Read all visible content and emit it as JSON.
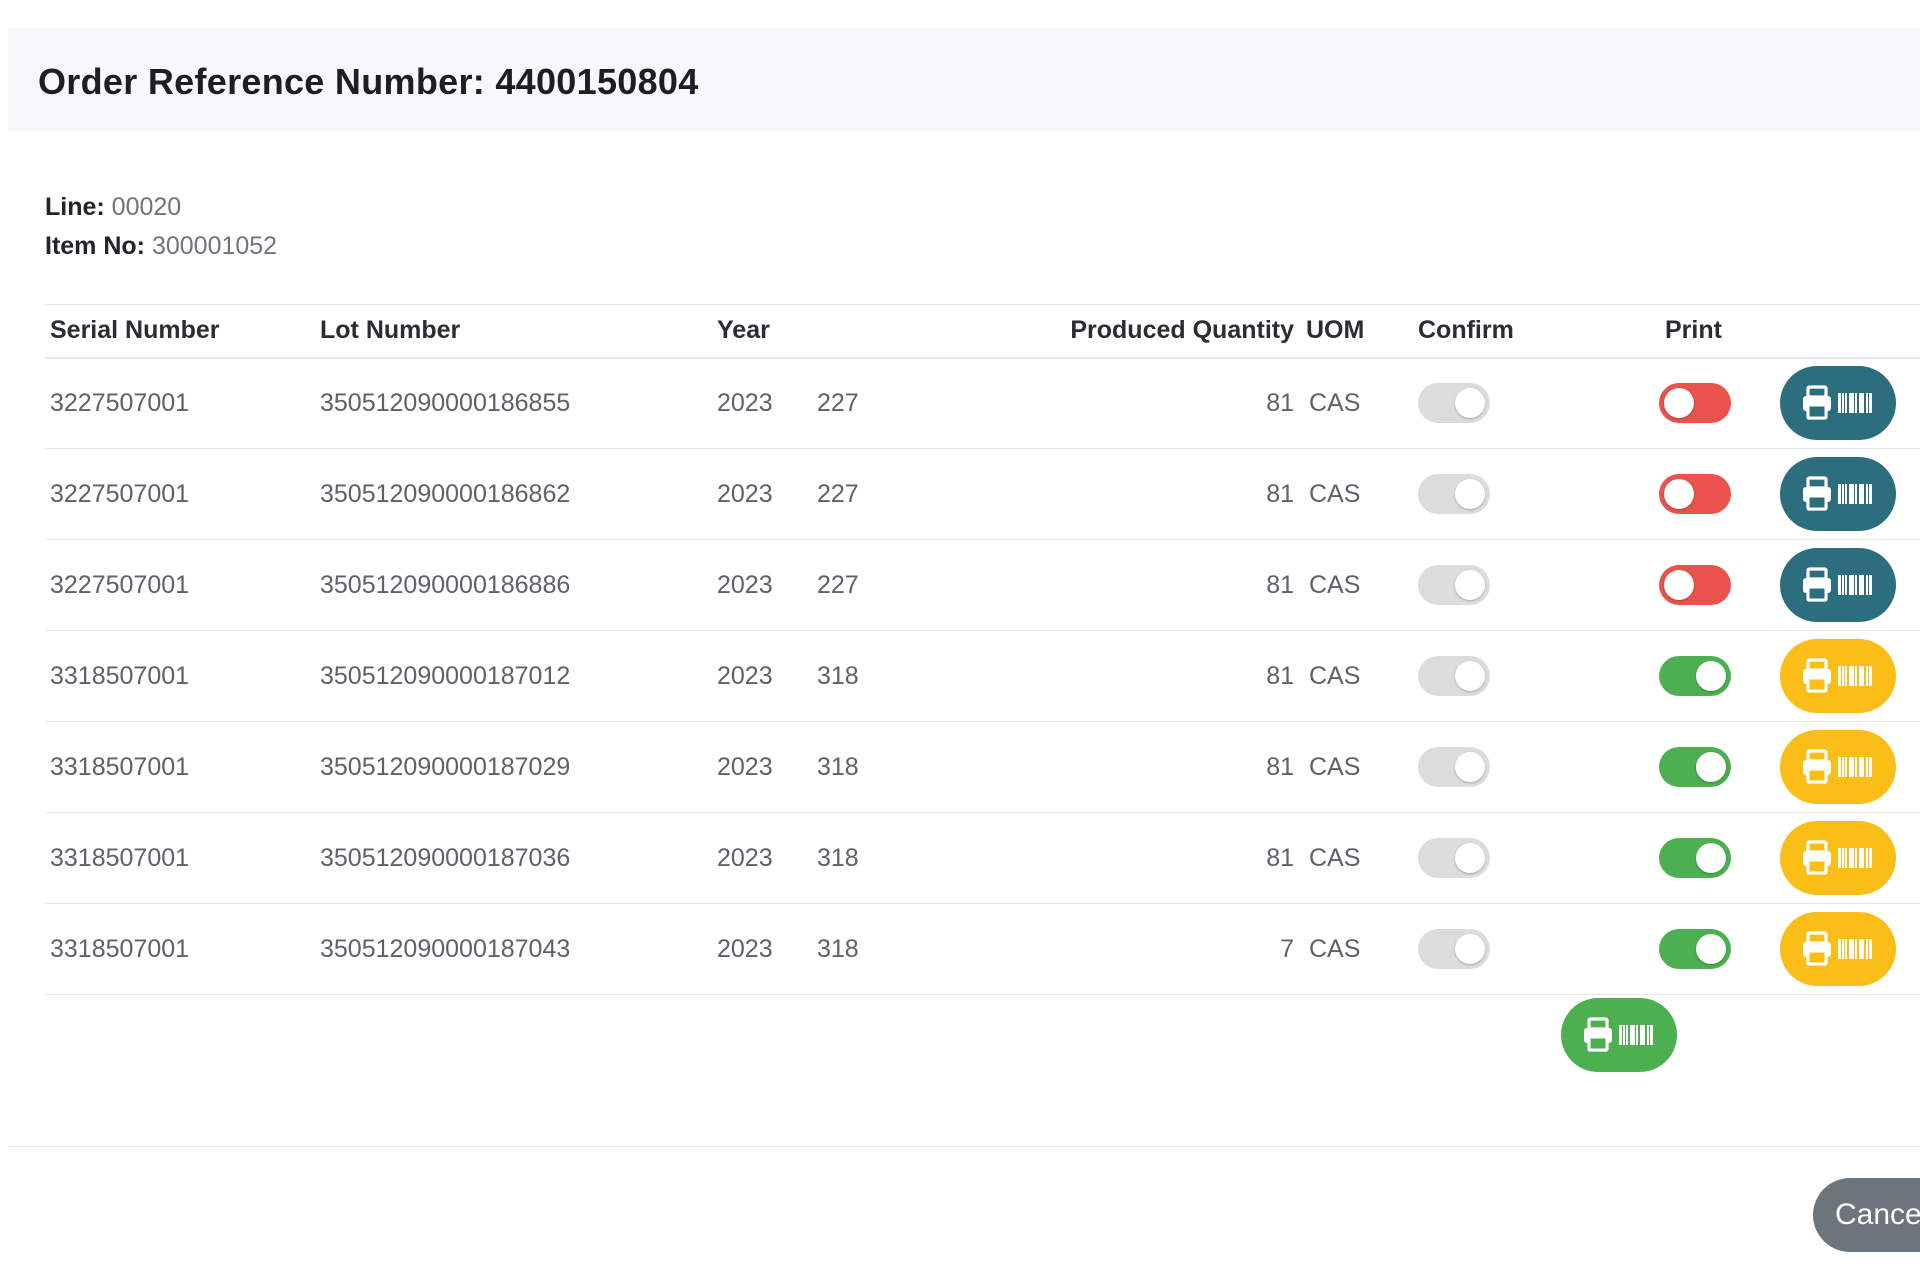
{
  "header": {
    "title": "Order Reference Number: 4400150804"
  },
  "info": {
    "line_label": "Line:",
    "line_value": "00020",
    "item_label": "Item No:",
    "item_value": "300001052"
  },
  "table": {
    "columns": [
      "Serial Number",
      "Lot Number",
      "Year",
      "",
      "Produced Quantity",
      "UOM",
      "Confirm",
      "Print",
      ""
    ],
    "rows": [
      {
        "serial": "3227507001",
        "lot": "350512090000186855",
        "year": "2023",
        "code": "227",
        "qty": "81",
        "uom": "CAS",
        "confirmed": false,
        "printed": false,
        "print_state": "done"
      },
      {
        "serial": "3227507001",
        "lot": "350512090000186862",
        "year": "2023",
        "code": "227",
        "qty": "81",
        "uom": "CAS",
        "confirmed": false,
        "printed": false,
        "print_state": "done"
      },
      {
        "serial": "3227507001",
        "lot": "350512090000186886",
        "year": "2023",
        "code": "227",
        "qty": "81",
        "uom": "CAS",
        "confirmed": false,
        "printed": false,
        "print_state": "done"
      },
      {
        "serial": "3318507001",
        "lot": "350512090000187012",
        "year": "2023",
        "code": "318",
        "qty": "81",
        "uom": "CAS",
        "confirmed": false,
        "printed": true,
        "print_state": "pending"
      },
      {
        "serial": "3318507001",
        "lot": "350512090000187029",
        "year": "2023",
        "code": "318",
        "qty": "81",
        "uom": "CAS",
        "confirmed": false,
        "printed": true,
        "print_state": "pending"
      },
      {
        "serial": "3318507001",
        "lot": "350512090000187036",
        "year": "2023",
        "code": "318",
        "qty": "81",
        "uom": "CAS",
        "confirmed": false,
        "printed": true,
        "print_state": "pending"
      },
      {
        "serial": "3318507001",
        "lot": "350512090000187043",
        "year": "2023",
        "code": "318",
        "qty": "7",
        "uom": "CAS",
        "confirmed": false,
        "printed": true,
        "print_state": "pending"
      }
    ]
  },
  "icons": {
    "row_print": "print-barcode-icon",
    "print_all": "print-barcode-icon"
  },
  "colors": {
    "toggle_off": "#e9534c",
    "toggle_on": "#4cb050",
    "toggle_disabled": "#dcdcdc",
    "print_done": "#2d6e7e",
    "print_pending": "#fbbd18",
    "print_all": "#4cb050",
    "cancel": "#6c757d"
  },
  "footer": {
    "cancel_label": "Cancel"
  }
}
